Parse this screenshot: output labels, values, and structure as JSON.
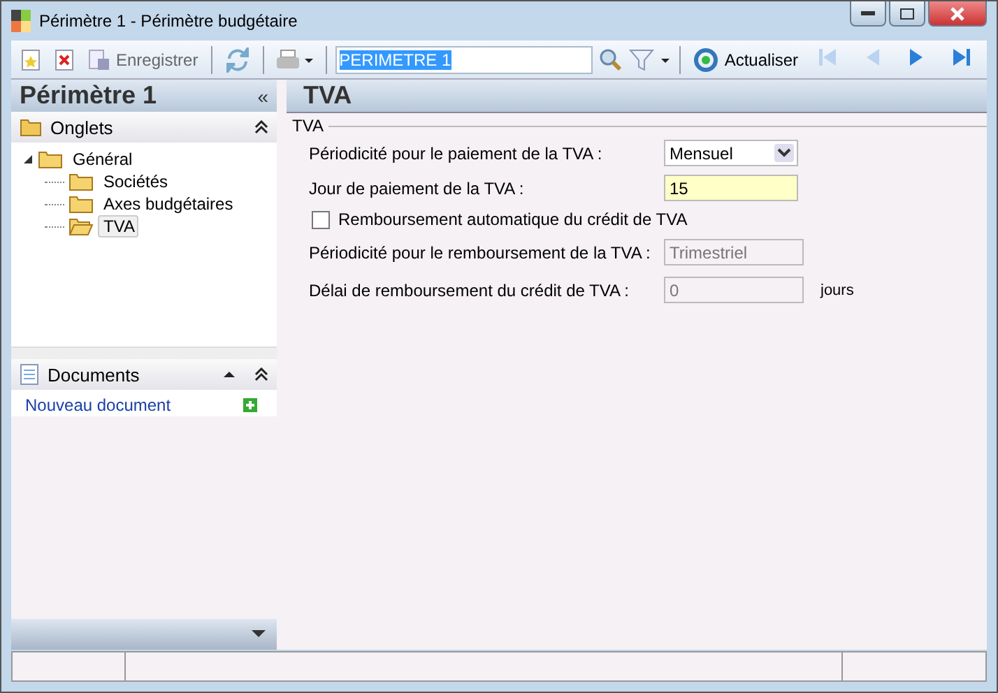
{
  "window": {
    "title": "Périmètre 1 -  Périmètre budgétaire"
  },
  "toolbar": [
    {
      "kind": "new"
    },
    {
      "kind": "delete"
    },
    {
      "kind": "save",
      "label": "Enregistrer",
      "disabled": true
    },
    {
      "kind": "sep"
    },
    {
      "kind": "refresh-arrows"
    },
    {
      "kind": "sep"
    },
    {
      "kind": "print"
    },
    {
      "kind": "sep"
    }
  ],
  "search": {
    "value": "PERIMETRE 1"
  },
  "toolbar_right": [
    {
      "kind": "refresh",
      "label": "Actualiser"
    },
    {
      "kind": "first",
      "disabled": true
    },
    {
      "kind": "prev",
      "disabled": true
    },
    {
      "kind": "next",
      "disabled": false
    },
    {
      "kind": "last",
      "disabled": false
    }
  ],
  "left_title": "Périmètre 1",
  "left_collapse": "«",
  "tabs_section": {
    "title": "Onglets"
  },
  "tree": [
    {
      "label": "Général",
      "expanded": true,
      "selected": false,
      "children": [
        {
          "label": "Sociétés",
          "selected": false
        },
        {
          "label": "Axes budgétaires",
          "selected": false
        },
        {
          "label": "TVA",
          "selected": true
        }
      ]
    }
  ],
  "documents": {
    "title": "Documents",
    "link": "Nouveau document"
  },
  "page_title": "TVA",
  "group_title": "TVA",
  "fields": [
    {
      "kind": "select",
      "label": "Périodicité pour le paiement de la TVA :",
      "value": "Mensuel"
    },
    {
      "kind": "input",
      "label": "Jour de paiement de la TVA :",
      "value": "15"
    },
    {
      "kind": "checkbox",
      "label": "Remboursement automatique du crédit de TVA",
      "checked": false
    },
    {
      "kind": "readonly",
      "label": "Périodicité pour le remboursement de la TVA :",
      "value": "Trimestriel"
    },
    {
      "kind": "readonly",
      "label": "Délai de remboursement du crédit de TVA :",
      "value": "0",
      "unit": "jours"
    }
  ]
}
